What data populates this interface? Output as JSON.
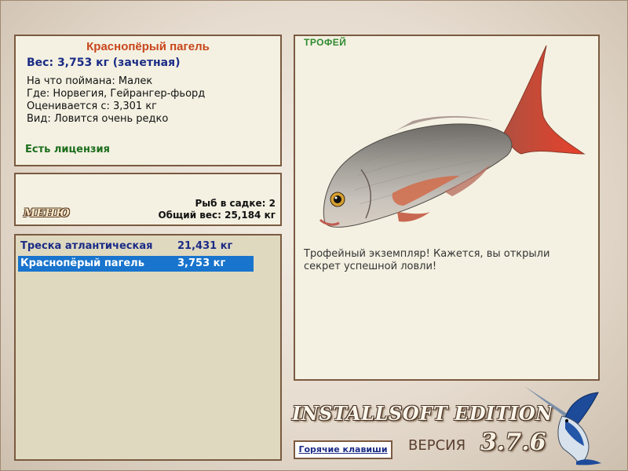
{
  "info": {
    "title": "Краснопёрый пагель",
    "weight": "Вес: 3,753 кг (зачетная)",
    "lines": [
      "На что поймана: Малек",
      "Где: Норвегия, Гейрангер-фьорд",
      "Оценивается с: 3,301 кг",
      "Вид: Ловится очень редко"
    ],
    "license": "Есть лицензия"
  },
  "menu": {
    "button_label": "МЕНЮ",
    "keep_count": "Рыб в садке: 2",
    "total_weight": "Общий вес: 25,184 кг"
  },
  "catch_list": [
    {
      "name": "Треска атлантическая",
      "weight": "21,431 кг",
      "selected": false
    },
    {
      "name": "Краснопёрый пагель",
      "weight": "3,753 кг",
      "selected": true
    }
  ],
  "trophy": {
    "label": "ТРОФЕЙ",
    "text": "Трофейный экземпляр! Кажется, вы открыли секрет успешной ловли!"
  },
  "footer": {
    "edition": "INSTALLSOFT EDITION",
    "version_label": "ВЕРСИЯ",
    "version_number": "3.7.6",
    "hotkeys_label": "Горячие клавиши"
  },
  "colors": {
    "title": "#c8461c",
    "weight": "#1b2c86",
    "license": "#1d6e1d",
    "selection": "#1874cd",
    "panel_border": "#7a5a40"
  },
  "icons": [
    "fish-image",
    "marlin-logo"
  ]
}
